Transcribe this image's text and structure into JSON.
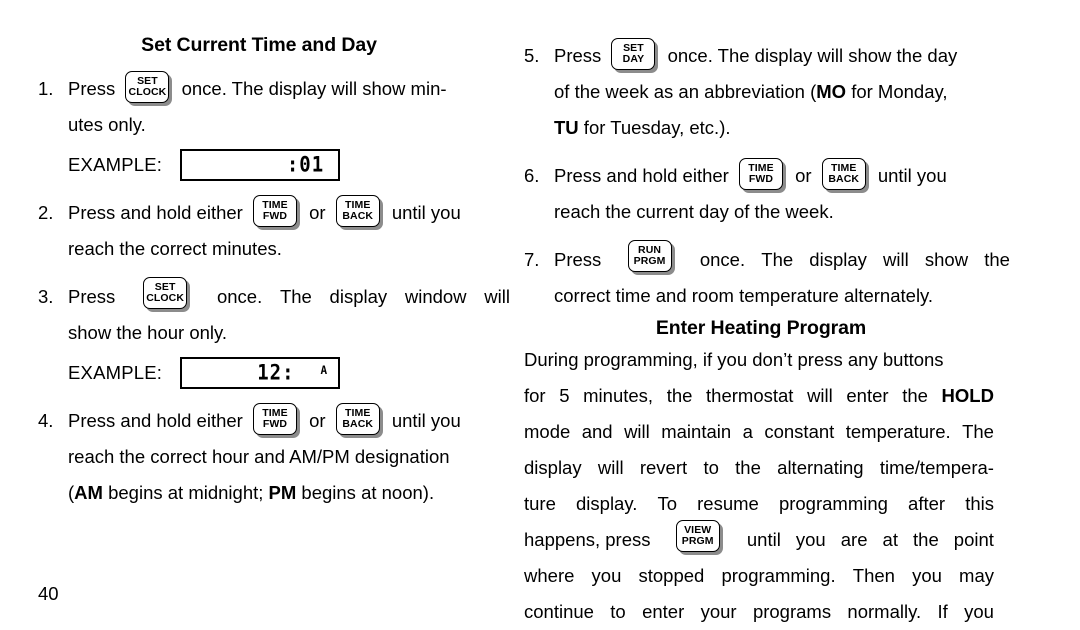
{
  "page": {
    "number": "40"
  },
  "left_column": {
    "title": "Set Current Time and Day",
    "steps": [
      {
        "num": "1.",
        "lead": "Press",
        "key": {
          "name": "set-clock-key",
          "line1": "SET",
          "line2": "CLOCK"
        },
        "line1_rest": "once. The display will show min-",
        "line2": "utes only."
      },
      {
        "num": "2.",
        "lead": "Press and hold either",
        "key1": {
          "name": "time-fwd-key",
          "line1": "TIME",
          "line2": "FWD"
        },
        "conj": "or",
        "key2": {
          "name": "time-back-key",
          "line1": "TIME",
          "line2": "BACK"
        },
        "line1_rest": "until you",
        "line2": "reach the correct minutes."
      },
      {
        "num": "3.",
        "lead": "Press",
        "key": {
          "name": "set-clock-key",
          "line1": "SET",
          "line2": "CLOCK"
        },
        "line1_words": [
          "once.",
          "The",
          "display",
          "window",
          "will"
        ],
        "line2": "show the hour only."
      },
      {
        "num": "4.",
        "lead": "Press and hold either",
        "key1": {
          "name": "time-fwd-key",
          "line1": "TIME",
          "line2": "FWD"
        },
        "conj": "or",
        "key2": {
          "name": "time-back-key",
          "line1": "TIME",
          "line2": "BACK"
        },
        "line1_rest": "until you",
        "line2": "reach the correct hour and AM/PM designation",
        "line3_a": "(",
        "line3_b": "AM",
        "line3_c": " begins at midnight; ",
        "line3_d": "PM",
        "line3_e": " begins at noon)."
      }
    ],
    "examples": [
      {
        "label": "EXAMPLE:",
        "lcd_main": ":01",
        "lcd_aux": ""
      },
      {
        "label": "EXAMPLE:",
        "lcd_main": "12:",
        "lcd_aux": "A"
      }
    ]
  },
  "right_column": {
    "steps": [
      {
        "num": "5.",
        "lead": "Press",
        "key": {
          "name": "set-day-key",
          "line1": "SET",
          "line2": "DAY"
        },
        "line1_rest": "once. The display will show the day",
        "line2_a": "of the week as an abbreviation (",
        "line2_b": "MO",
        "line2_c": " for Monday,",
        "line3_a": "TU",
        "line3_b": " for Tuesday, etc.)."
      },
      {
        "num": "6.",
        "lead": "Press and hold either",
        "key1": {
          "name": "time-fwd-key",
          "line1": "TIME",
          "line2": "FWD"
        },
        "conj": "or",
        "key2": {
          "name": "time-back-key",
          "line1": "TIME",
          "line2": "BACK"
        },
        "line1_rest": "until you",
        "line2": "reach the current day of the week."
      },
      {
        "num": "7.",
        "lead": "Press",
        "key": {
          "name": "run-prgm-key",
          "line1": "RUN",
          "line2": "PRGM"
        },
        "line1_words": [
          "once.",
          "The",
          "display",
          "will",
          "show",
          "the"
        ],
        "line2": "correct time and room temperature alternately."
      }
    ],
    "title2": "Enter Heating Program",
    "body": {
      "line1": "During programming, if you don’t press any buttons",
      "line2_words": [
        "for",
        "5",
        "minutes,",
        "the",
        "thermostat",
        "will",
        "enter",
        "the"
      ],
      "line2_bold": "HOLD",
      "line3_words": [
        "mode",
        "and",
        "will",
        "maintain",
        "a",
        "constant",
        "temperature.",
        "The"
      ],
      "line4_words": [
        "display",
        "will",
        "revert",
        "to",
        "the",
        "alternating",
        "time/tempera-"
      ],
      "line5_words": [
        "ture",
        "display.",
        "To",
        "resume",
        "programming",
        "after",
        "this"
      ],
      "line6_pre": "happens, press",
      "line6_key": {
        "name": "view-prgm-key",
        "line1": "VIEW",
        "line2": "PRGM"
      },
      "line6_words": [
        "until",
        "you",
        "are",
        "at",
        "the",
        "point"
      ],
      "line7_words": [
        "where",
        "you",
        "stopped",
        "programming.",
        "Then",
        "you",
        "may"
      ],
      "line8_words": [
        "continue",
        "to",
        "enter",
        "your",
        "programs",
        "normally.",
        "If",
        "you"
      ]
    }
  }
}
